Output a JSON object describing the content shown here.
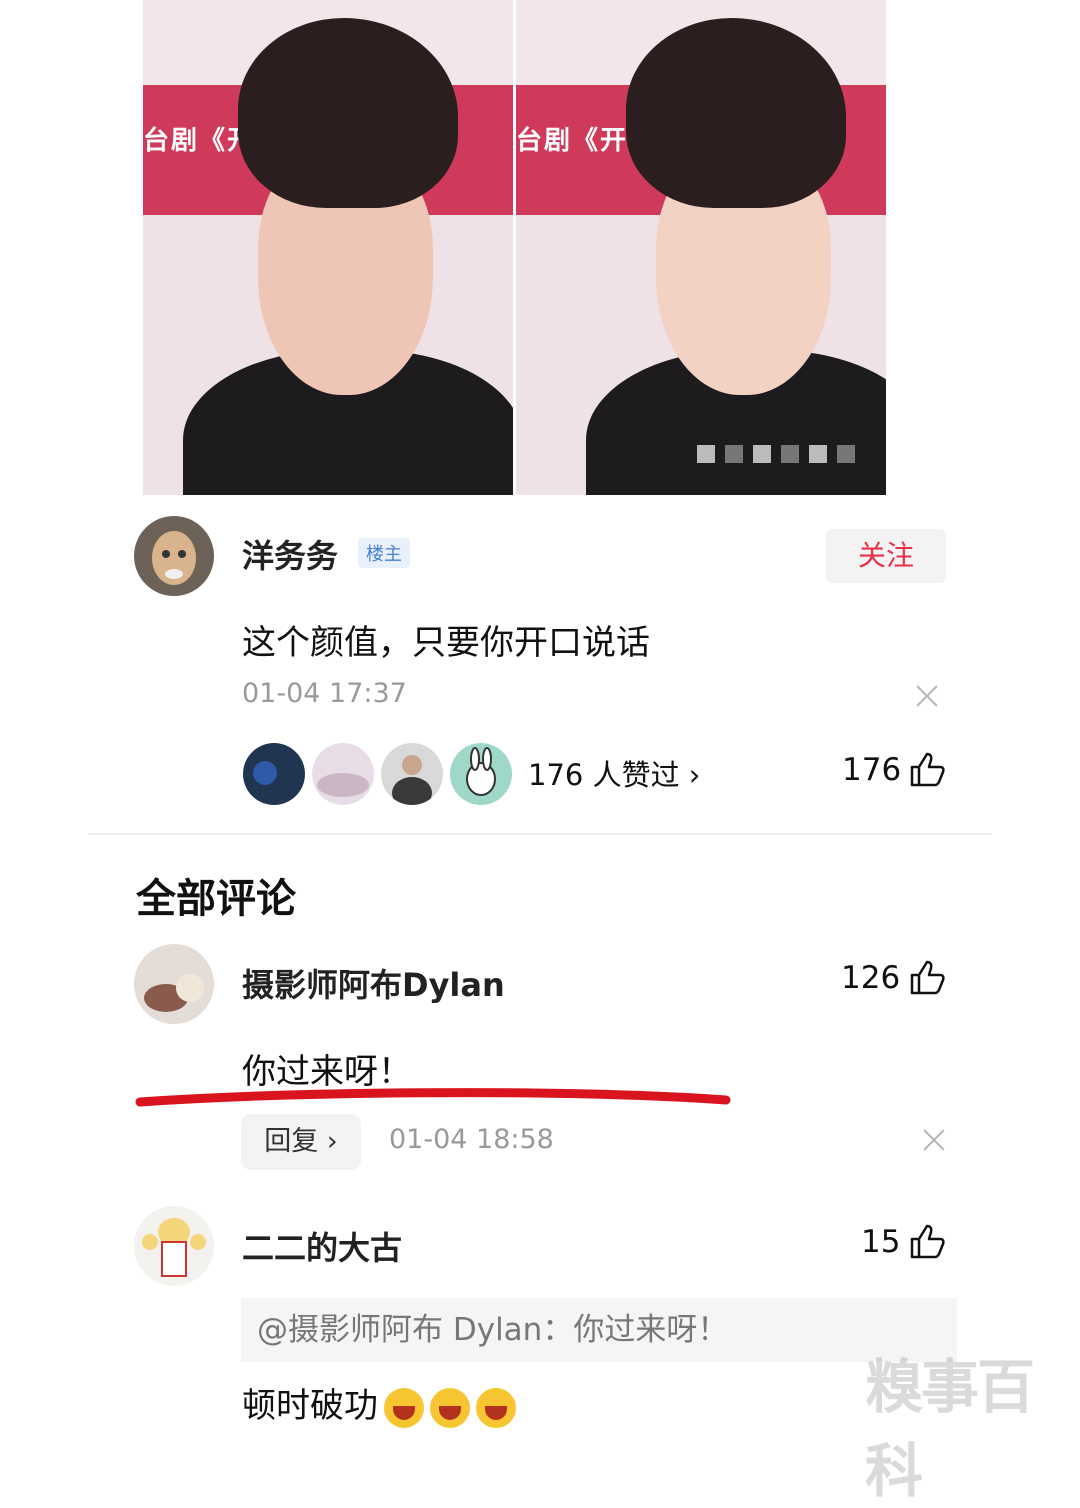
{
  "photos": {
    "left_banner": "台剧《开",
    "right_banner": "台剧《开"
  },
  "post": {
    "author": "洋务务",
    "badge": "楼主",
    "follow_label": "关注",
    "content": "这个颜值，只要你开口说话",
    "time": "01-04 17:37",
    "likers_label": "176 人赞过 ›",
    "like_count": "176"
  },
  "comments_section": {
    "title": "全部评论"
  },
  "comments": [
    {
      "author": "摄影师阿布Dylan",
      "like_count": "126",
      "content": "你过来呀！",
      "reply_label": "回复 ›",
      "time": "01-04 18:58"
    },
    {
      "author": "二二的大古",
      "like_count": "15",
      "quote": "@摄影师阿布 Dylan：你过来呀！",
      "content": "顿时破功"
    }
  ],
  "watermark": "糗事百科",
  "colors": {
    "accent_red": "#e8334a",
    "badge_blue": "#4a7fd1",
    "underline_red": "#d9141f"
  }
}
